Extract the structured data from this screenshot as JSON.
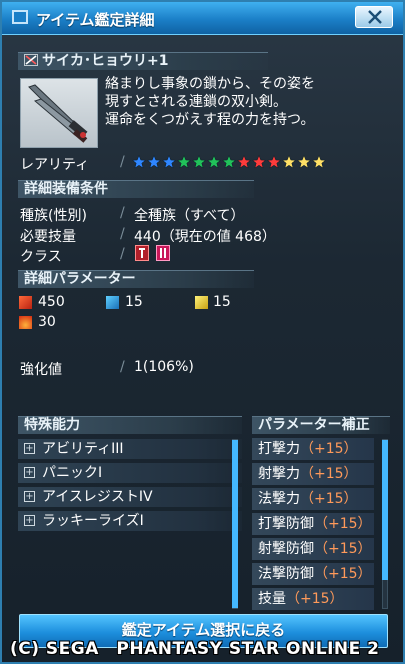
{
  "window": {
    "title": "アイテム鑑定詳細",
    "close_icon": "close-icon"
  },
  "item": {
    "name": "サイカ･ヒョウリ+1",
    "description": [
      "絡まりし事象の鎖から、その姿を",
      "現すとされる連鎖の双小剣。",
      "運命をくつがえす程の力を持つ。"
    ],
    "rarity_label": "レアリティ",
    "rarity_stars": 13,
    "star_colors": [
      "#2f86ff",
      "#2f86ff",
      "#2f86ff",
      "#21c25a",
      "#21c25a",
      "#21c25a",
      "#21c25a",
      "#ff3b3b",
      "#ff3b3b",
      "#ff3b3b",
      "#ffe066",
      "#ffe066",
      "#ffe066"
    ]
  },
  "equip_conditions": {
    "header": "詳細装備条件",
    "race_label": "種族(性別)",
    "race_value": "全種族（すべて）",
    "skill_label": "必要技量",
    "skill_value": "440（現在の値 468）",
    "class_label": "クラス"
  },
  "parameters": {
    "header": "詳細パラメーター",
    "striking": "450",
    "ranged": "15",
    "technique": "15",
    "fire": "30"
  },
  "grind": {
    "label": "強化値",
    "value": "1(106%)"
  },
  "special_abilities": {
    "header": "特殊能力",
    "items": [
      "アビリティIII",
      "パニックI",
      "アイスレジストIV",
      "ラッキーライズI"
    ]
  },
  "parameter_bonus": {
    "header": "パラメーター補正",
    "items": [
      {
        "label": "打撃力",
        "value": "（+15）"
      },
      {
        "label": "射撃力",
        "value": "（+15）"
      },
      {
        "label": "法撃力",
        "value": "（+15）"
      },
      {
        "label": "打撃防御",
        "value": "（+15）"
      },
      {
        "label": "射撃防御",
        "value": "（+15）"
      },
      {
        "label": "法撃防御",
        "value": "（+15）"
      },
      {
        "label": "技量",
        "value": "（+15）"
      }
    ]
  },
  "buttons": {
    "back": "鑑定アイテム選択に戻る"
  },
  "copyright": "(C) SEGA　PHANTASY STAR ONLINE 2"
}
